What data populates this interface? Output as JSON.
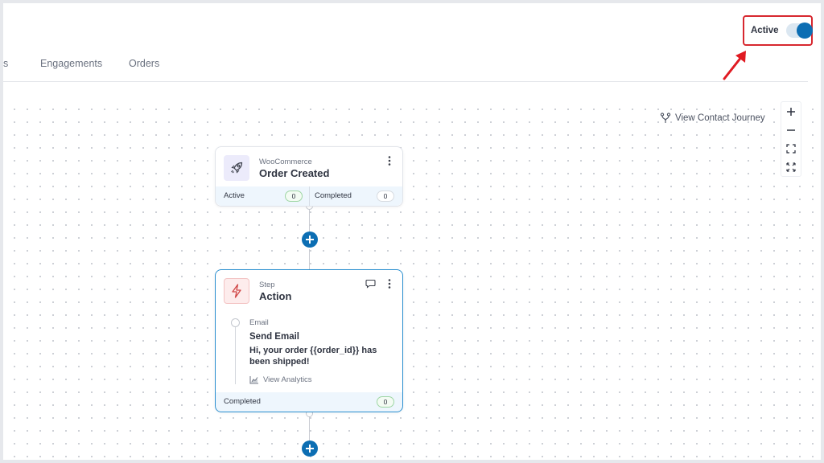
{
  "header": {
    "tabs": [
      {
        "label": "s"
      },
      {
        "label": "Engagements"
      },
      {
        "label": "Orders"
      }
    ],
    "toggle": {
      "label": "Active",
      "on": true
    }
  },
  "canvas": {
    "journey_link": "View Contact Journey",
    "zoom": {
      "icons": [
        "plus-icon",
        "minus-icon",
        "fit-screen-icon",
        "expand-icon"
      ]
    }
  },
  "trigger_node": {
    "icon": "rocket-icon",
    "subtitle": "WooCommerce",
    "title": "Order Created",
    "footer": {
      "active_label": "Active",
      "active_count": "0",
      "completed_label": "Completed",
      "completed_count": "0"
    }
  },
  "action_node": {
    "icon": "lightning-icon",
    "subtitle": "Step",
    "title": "Action",
    "email": {
      "type": "Email",
      "name": "Send Email",
      "body": "Hi, your order {{order_id}} has been shipped!",
      "analytics_label": "View Analytics"
    },
    "footer": {
      "completed_label": "Completed",
      "completed_count": "0"
    }
  },
  "colors": {
    "accent": "#0c6eb3",
    "highlight": "#d7272f",
    "selected_border": "#2a8fd0"
  }
}
